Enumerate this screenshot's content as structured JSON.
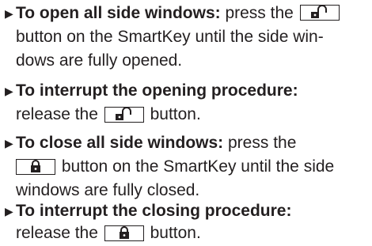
{
  "items": [
    {
      "heading": "To open all side windows:",
      "lines": [
        " press the",
        "button on the SmartKey until the side win-",
        "dows are fully opened."
      ],
      "icon": "unlock-icon"
    },
    {
      "heading": "To interrupt the opening procedure:",
      "lines": [
        "release the",
        "button."
      ],
      "icon": "unlock-icon"
    },
    {
      "heading": "To close all side windows:",
      "lines": [
        " press the",
        "button on the SmartKey until the side",
        "windows are fully closed."
      ],
      "icon": "lock-icon"
    },
    {
      "heading": "To interrupt the closing procedure:",
      "lines": [
        "release the",
        "button."
      ],
      "icon": "lock-icon"
    }
  ],
  "bullet_symbol": "▶"
}
